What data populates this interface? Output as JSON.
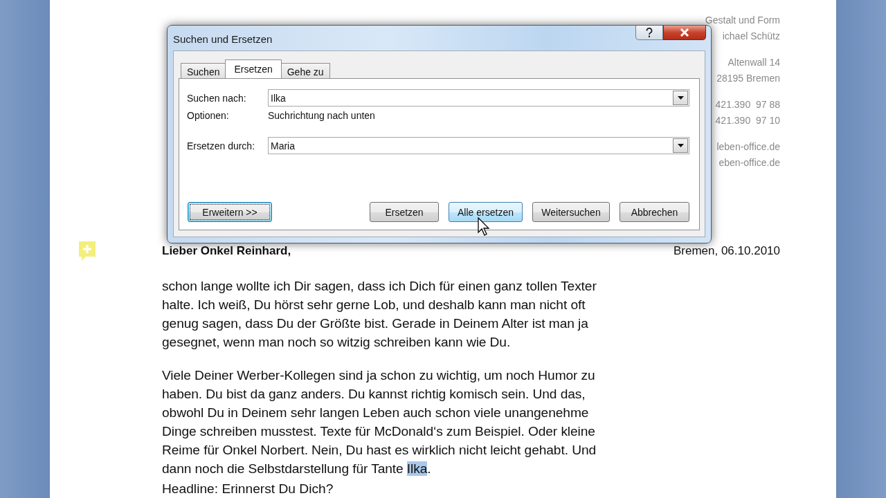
{
  "document": {
    "sender_groups": [
      {
        "lines": [
          "Gestalt und Form",
          "ichael Schütz"
        ]
      },
      {
        "lines": [
          "Altenwall 14",
          "28195 Bremen"
        ]
      },
      {
        "lines": [
          "421.390  97 88",
          "421.390  97 10"
        ]
      },
      {
        "lines": [
          "leben-office.de",
          "eben-office.de"
        ]
      }
    ],
    "greeting": "Lieber Onkel Reinhard,",
    "date": "Bremen, 06.10.2010",
    "paragraphs": [
      {
        "segments": [
          {
            "text": "schon lange wollte ich Dir sagen, dass ich Dich für einen ganz tollen Texter halte. Ich weiß, Du hörst sehr gerne Lob, und deshalb kann man nicht oft genug sagen, dass Du der Größte bist. Gerade in Deinem Alter ist man ja gesegnet, wenn man noch so witzig schreiben kann wie Du.",
            "highlighted": false
          }
        ]
      },
      {
        "segments": [
          {
            "text": "Viele Deiner Werber-Kollegen sind ja schon zu wichtig, um noch Humor zu haben. Du bist da ganz anders. Du kannst richtig komisch sein. Und das, obwohl Du in Deinem sehr langen Leben auch schon viele unangenehme Dinge schreiben musstest. Texte für McDonald‘s zum Beispiel. Oder kleine Reime für Onkel Norbert. Nein, Du hast es wirklich nicht leicht gehabt. Und dann noch die Selbstdarstellung für Tante ",
            "highlighted": false
          },
          {
            "text": "Ilka",
            "highlighted": true
          },
          {
            "text": ".",
            "highlighted": false
          }
        ]
      }
    ],
    "headline": "Headline: Erinnerst Du Dich?"
  },
  "dialog": {
    "title": "Suchen und Ersetzen",
    "tabs": [
      {
        "label": "Suchen",
        "selected": false
      },
      {
        "label": "Ersetzen",
        "selected": true
      },
      {
        "label": "Gehe zu",
        "selected": false
      }
    ],
    "rows": [
      {
        "kind": "combo",
        "label": "Suchen nach:",
        "value": "Ilka"
      },
      {
        "kind": "info",
        "label": "Optionen:",
        "value": "Suchrichtung nach unten"
      },
      {
        "kind": "combo",
        "label": "Ersetzen durch:",
        "value": "Maria"
      }
    ],
    "buttons": [
      {
        "label": "Erweitern >>",
        "focused": true,
        "hovered": false
      },
      {
        "label": "Ersetzen",
        "focused": false,
        "hovered": false
      },
      {
        "label": "Alle ersetzen",
        "focused": false,
        "hovered": true
      },
      {
        "label": "Weitersuchen",
        "focused": false,
        "hovered": false
      },
      {
        "label": "Abbrechen",
        "focused": false,
        "hovered": false
      }
    ]
  }
}
